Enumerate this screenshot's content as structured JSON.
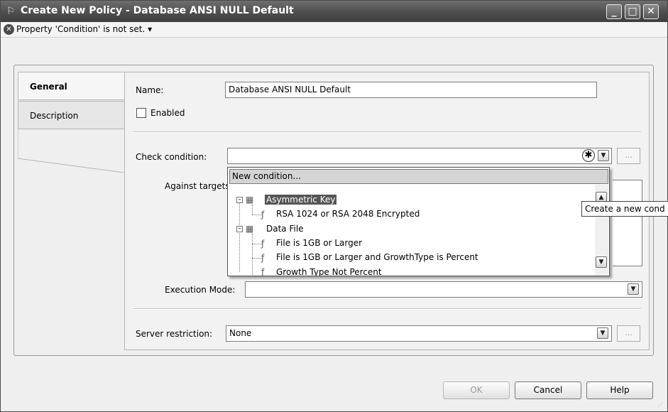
{
  "window": {
    "title": "Create New Policy - Database ANSI NULL Default",
    "minimize_glyph": "_",
    "maximize_glyph": "□",
    "close_glyph": "✕"
  },
  "status": {
    "message": "Property 'Condition' is not set.",
    "dropdown_glyph": "▾"
  },
  "tabs": [
    {
      "label": "General"
    },
    {
      "label": "Description"
    }
  ],
  "form": {
    "name_label": "Name:",
    "name_value": "Database ANSI NULL Default",
    "enabled_label": "Enabled",
    "check_condition_label": "Check condition:",
    "against_targets_label": "Against targets:",
    "execution_mode_label": "Execution Mode:",
    "server_restriction_label": "Server restriction:",
    "server_restriction_value": "None",
    "ellipsis_label": "..."
  },
  "condition_dropdown": {
    "new_condition_label": "New condition...",
    "tree": [
      {
        "label": "Asymmetric Key",
        "type": "facet"
      },
      {
        "label": "RSA 1024 or RSA 2048 Encrypted",
        "type": "condition"
      },
      {
        "label": "Data File",
        "type": "facet"
      },
      {
        "label": "File is 1GB or Larger",
        "type": "condition"
      },
      {
        "label": "File is 1GB or Larger and GrowthType is Percent",
        "type": "condition"
      },
      {
        "label": "Growth Type Not Percent",
        "type": "condition"
      }
    ]
  },
  "tooltip": {
    "text": "Create a new cond"
  },
  "buttons": {
    "ok": "OK",
    "cancel": "Cancel",
    "help": "Help"
  },
  "icons": {
    "window_icon": "policy-icon",
    "status_icon": "error-icon",
    "new_condition_icon": "new-condition-icon",
    "facet_icon": "facet-icon",
    "condition_icon": "condition-icon"
  }
}
